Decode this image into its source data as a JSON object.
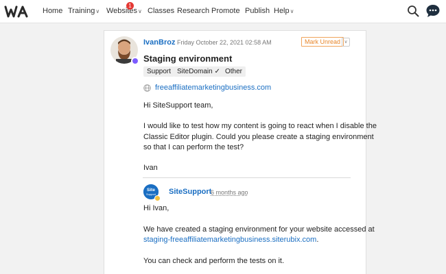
{
  "nav": {
    "items": [
      {
        "label": "Home",
        "caret": false
      },
      {
        "label": "Training",
        "caret": true
      },
      {
        "label": "Websites",
        "caret": true
      },
      {
        "label": "Classes",
        "caret": false
      },
      {
        "label": "Research",
        "caret": false
      },
      {
        "label": "Promote",
        "caret": false
      },
      {
        "label": "Publish",
        "caret": false
      },
      {
        "label": "Help",
        "caret": true
      }
    ],
    "websites_badge": "1",
    "caret_glyph": "∨"
  },
  "post": {
    "author": "IvanBroz",
    "date": "Friday October 22, 2021 02:58 AM",
    "mark_unread": "Mark Unread",
    "more_glyph": "∨",
    "title": "Staging environment",
    "tags": [
      "Support",
      "SiteDomain ✓",
      "Other"
    ],
    "link": "freeaffiliatemarketingbusiness.com",
    "body": [
      "Hi SiteSupport team,",
      "I would like to test how my content is going to react when I disable the",
      "Classic Editor plugin. Could you please create a staging environment",
      "so that I can perform the test?",
      "Ivan"
    ]
  },
  "reply": {
    "author": "SiteSupport",
    "avatar_text": [
      "Site",
      "Support"
    ],
    "time": "6 months ago",
    "greeting": "Hi Ivan,",
    "line1": "We have created a staging environment for your website accessed at",
    "link": "staging-freeaffiliatemarketingbusiness.siterubix.com",
    "link_suffix": ".",
    "line3": "You can check and perform the tests on it."
  },
  "colors": {
    "accent": "#1a6ec2",
    "mark_unread": "#e8862a",
    "badge": "#e53935",
    "status": "#7c5cff"
  },
  "icons": {
    "logo": "wa-logo",
    "search": "search-icon",
    "chat": "chat-icon",
    "globe": "globe-icon"
  }
}
